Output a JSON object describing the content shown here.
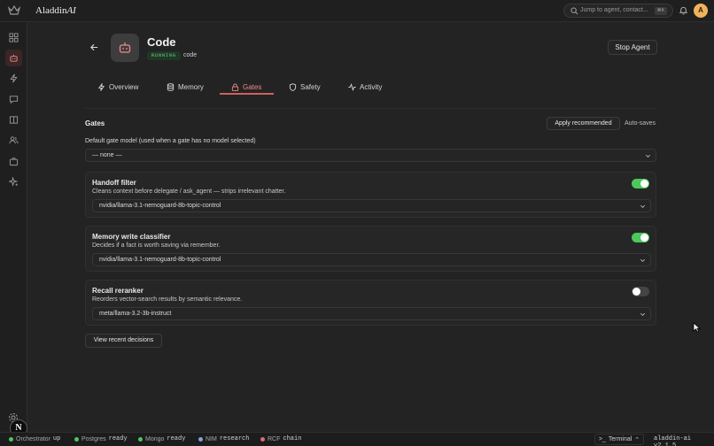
{
  "app": {
    "brand_main": "Aladdin",
    "brand_ai": "AI",
    "search_placeholder": "Jump to agent, contact...",
    "search_shortcut": "⌘K",
    "avatar_initial": "A"
  },
  "sidebar": {
    "items": [
      {
        "icon": "dashboard-grid-icon",
        "active": false
      },
      {
        "icon": "bot-icon",
        "active": true
      },
      {
        "icon": "lightning-icon",
        "active": false
      },
      {
        "icon": "chat-icon",
        "active": false
      },
      {
        "icon": "book-icon",
        "active": false
      },
      {
        "icon": "users-icon",
        "active": false
      },
      {
        "icon": "briefcase-icon",
        "active": false
      },
      {
        "icon": "sparkles-icon",
        "active": false
      }
    ],
    "bottom_badge": "N"
  },
  "agent": {
    "name": "Code",
    "status": "RUNNING",
    "slug": "code",
    "stop_label": "Stop Agent"
  },
  "tabs": [
    {
      "label": "Overview",
      "icon": "lightning-icon"
    },
    {
      "label": "Memory",
      "icon": "database-icon"
    },
    {
      "label": "Gates",
      "icon": "lock-icon",
      "active": true
    },
    {
      "label": "Safety",
      "icon": "shield-icon"
    },
    {
      "label": "Activity",
      "icon": "activity-icon"
    }
  ],
  "gates": {
    "title": "Gates",
    "apply_label": "Apply recommended",
    "autosave_label": "Auto-saves",
    "default_label": "Default gate model (used when a gate has no model selected)",
    "default_value": "— none —",
    "cards": [
      {
        "title": "Handoff filter",
        "description": "Cleans context before delegate / ask_agent — strips irrelevant chatter.",
        "model": "nvidia/llama-3.1-nemoguard-8b-topic-control",
        "enabled": true
      },
      {
        "title": "Memory write classifier",
        "description": "Decides if a fact is worth saving via remember.",
        "model": "nvidia/llama-3.1-nemoguard-8b-topic-control",
        "enabled": true
      },
      {
        "title": "Recall reranker",
        "description": "Reorders vector-search results by semantic relevance.",
        "model": "meta/llama-3.2-3b-instruct",
        "enabled": false
      }
    ],
    "recent_label": "View recent decisions"
  },
  "statusbar": {
    "items": [
      {
        "label": "Orchestrator",
        "value": "up",
        "color": "#4cc85c"
      },
      {
        "label": "Postgres",
        "value": "ready",
        "color": "#4cc85c"
      },
      {
        "label": "Mongo",
        "value": "ready",
        "color": "#4cc85c"
      },
      {
        "label": "NIM",
        "value": "research",
        "color": "#8aa0e0"
      },
      {
        "label": "RCF",
        "value": "chain",
        "color": "#e06a6a"
      }
    ],
    "terminal_label": "Terminal",
    "version": "aladdin-ai v2.1.5"
  },
  "colors": {
    "accent": "#d06060",
    "toggle_on": "#4cc85c",
    "avatar": "#f0b35c",
    "running_badge_text": "#7fd08f"
  }
}
